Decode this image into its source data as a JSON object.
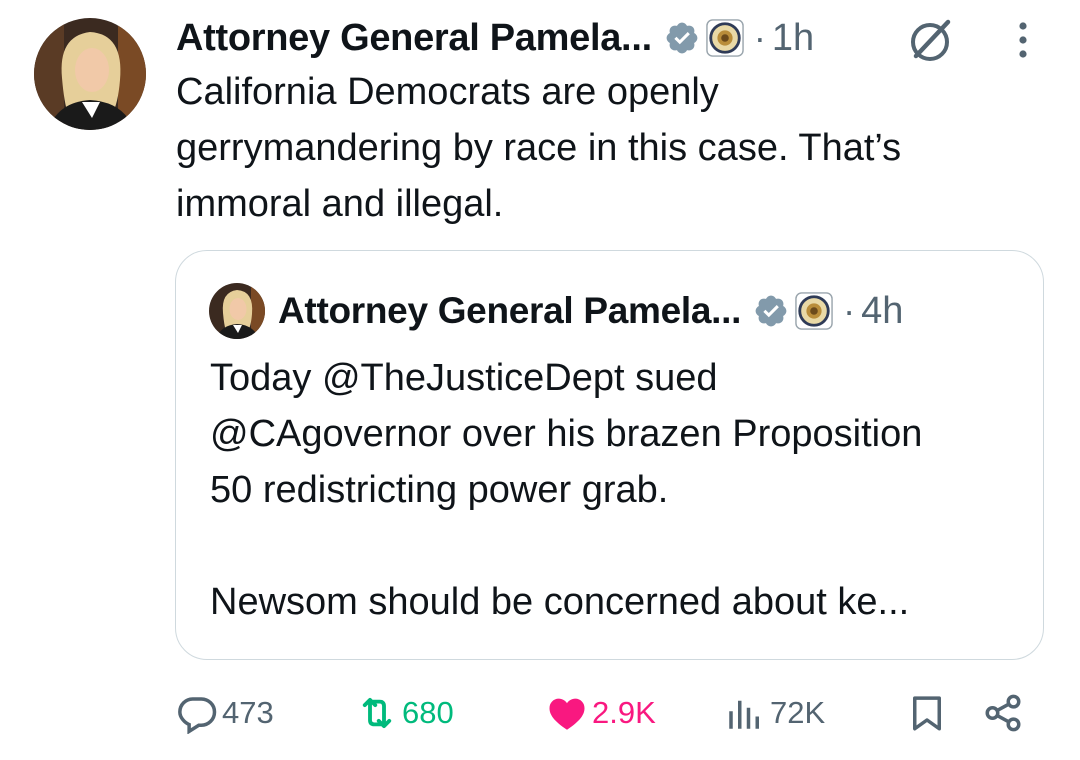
{
  "tweet": {
    "author_name": "Attorney General Pamela...",
    "time": "1h",
    "separator": "·",
    "text": "California Democrats are openly\ngerrymandering by race in this case. That’s\nimmoral and illegal."
  },
  "quoted": {
    "author_name": "Attorney General Pamela...",
    "time": "4h",
    "separator": "·",
    "text": "Today @TheJusticeDept sued\n@CAgovernor over his brazen Proposition\n50 redistricting power grab.\n\nNewsom should be concerned about ke..."
  },
  "actions": {
    "replies": "473",
    "reposts": "680",
    "likes": "2.9K",
    "views": "72K"
  },
  "colors": {
    "verified": "#829aab",
    "repost": "#00ba7c",
    "like": "#f91880",
    "muted": "#536471",
    "border": "#cfd9de"
  },
  "icons": [
    "avatar",
    "verified-badge-icon",
    "doj-seal-icon",
    "grok-icon",
    "more-icon",
    "reply-icon",
    "repost-icon",
    "like-icon",
    "views-icon",
    "bookmark-icon",
    "share-icon"
  ]
}
